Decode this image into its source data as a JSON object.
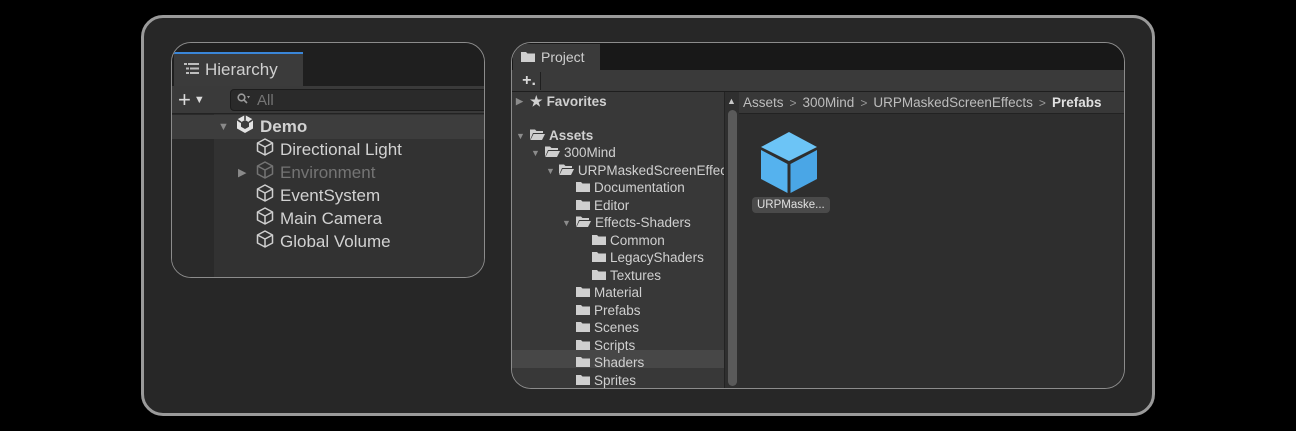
{
  "hierarchy": {
    "tab_label": "Hierarchy",
    "add_button": "+",
    "search_placeholder": "All",
    "scene": "Demo",
    "objects": [
      {
        "label": "Directional Light",
        "dim": false
      },
      {
        "label": "Environment",
        "dim": true,
        "collapsed": true
      },
      {
        "label": "EventSystem",
        "dim": false
      },
      {
        "label": "Main Camera",
        "dim": false
      },
      {
        "label": "Global Volume",
        "dim": false
      }
    ]
  },
  "project": {
    "tab_label": "Project",
    "add_button": "+.",
    "favorites": "Favorites",
    "tree": [
      {
        "label": "Assets"
      },
      {
        "label": "300Mind"
      },
      {
        "label": "URPMaskedScreenEffects"
      },
      {
        "label": "Documentation"
      },
      {
        "label": "Editor"
      },
      {
        "label": "Effects-Shaders"
      },
      {
        "label": "Common"
      },
      {
        "label": "LegacyShaders"
      },
      {
        "label": "Textures"
      },
      {
        "label": "Material"
      },
      {
        "label": "Prefabs",
        "selected": true
      },
      {
        "label": "Scenes"
      },
      {
        "label": "Scripts"
      },
      {
        "label": "Shaders"
      },
      {
        "label": "Sprites"
      }
    ],
    "breadcrumb": [
      "Assets",
      "300Mind",
      "URPMaskedScreenEffects",
      "Prefabs"
    ],
    "assets": [
      {
        "label": "URPMaske...",
        "icon": "prefab-cube-icon",
        "color": "#5bb8f2"
      }
    ]
  },
  "colors": {
    "frame_border": "#9a9a9a",
    "tab_accent": "#3a86d8",
    "prefab_blue": "#5bb8f2"
  }
}
